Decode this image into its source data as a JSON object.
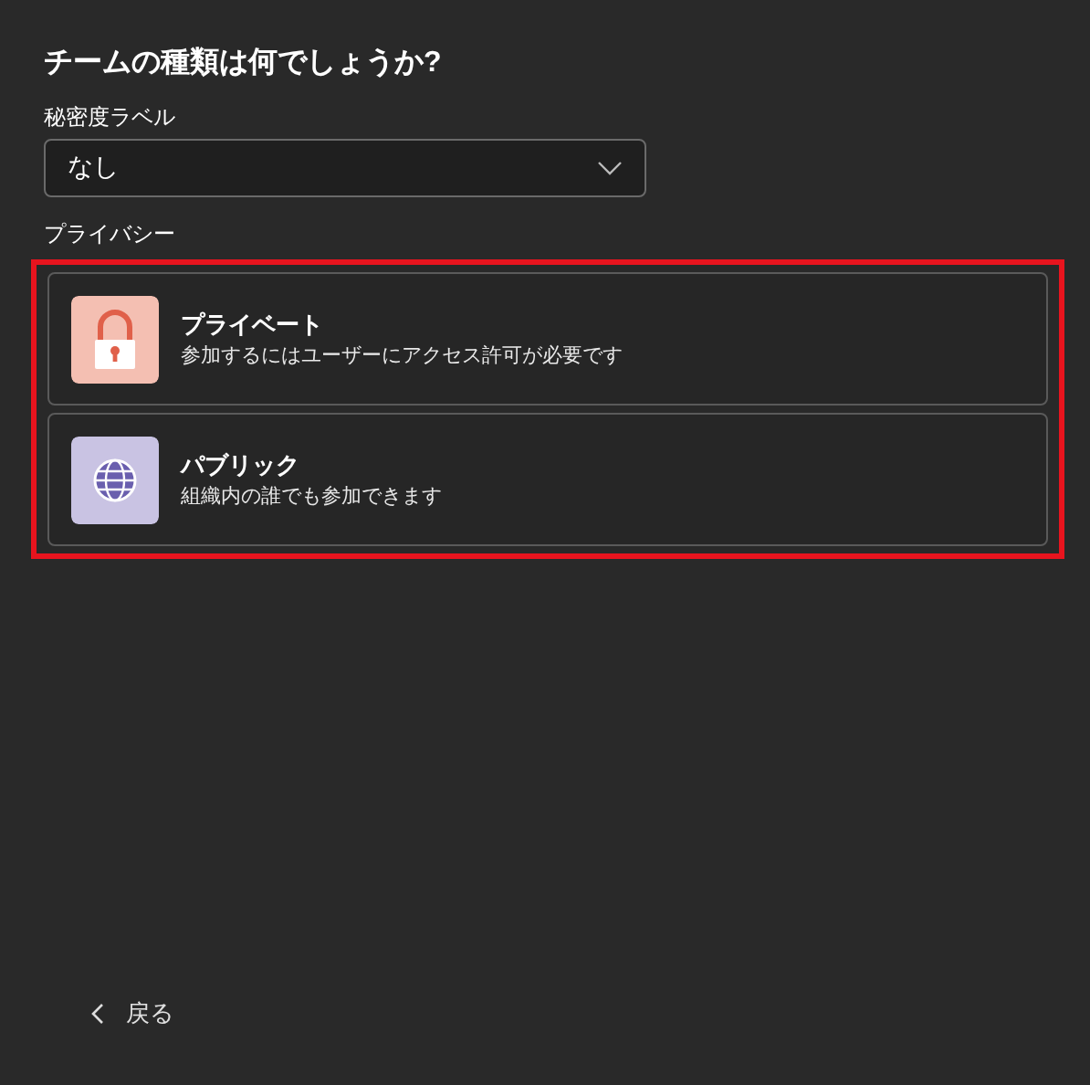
{
  "title": "チームの種類は何でしょうか?",
  "sensitivity": {
    "label": "秘密度ラベル",
    "value": "なし"
  },
  "privacy": {
    "label": "プライバシー",
    "highlighted": true,
    "options": [
      {
        "kind": "private",
        "title": "プライベート",
        "description": "参加するにはユーザーにアクセス許可が必要です"
      },
      {
        "kind": "public",
        "title": "パブリック",
        "description": "組織内の誰でも参加できます"
      }
    ]
  },
  "back": {
    "label": "戻る"
  }
}
